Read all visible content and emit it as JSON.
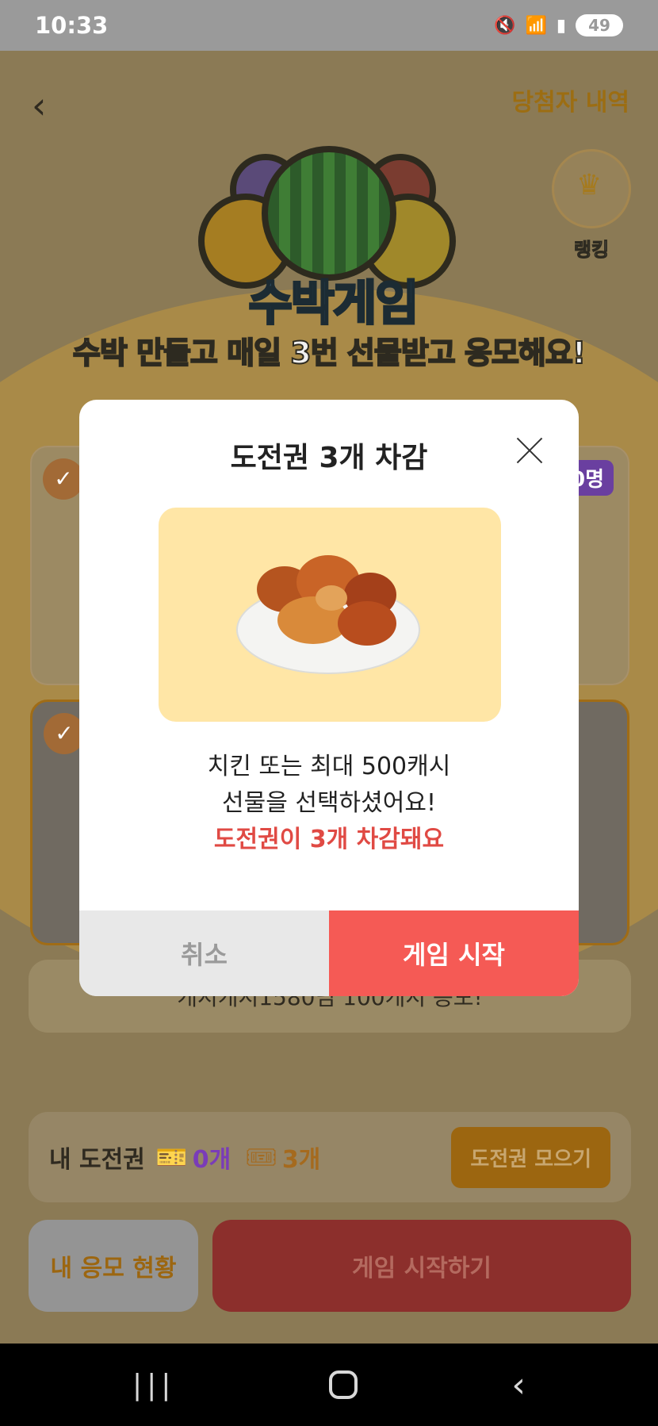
{
  "status_bar": {
    "time": "10:33",
    "battery": "49",
    "icons": [
      "mute-icon",
      "wifi-icon",
      "signal-icon",
      "battery-icon"
    ]
  },
  "header": {
    "winners_link": "당첨자 내역"
  },
  "logo": {
    "text": "수박게임"
  },
  "ranking": {
    "label": "랭킹"
  },
  "headline": "수박 만들고 매일 3번 선물받고 응모해요!",
  "background_card": {
    "count_badge": "0명"
  },
  "notice": "캐시캐시1580님 100개시 응모!",
  "tickets": {
    "label": "내 도전권",
    "purple_count": "0개",
    "orange_count": "3개",
    "collect_button": "도전권 모으기"
  },
  "my_entries_button": "내 응모 현황",
  "start_game_big_button": "게임 시작하기",
  "modal": {
    "title": "도전권 3개 차감",
    "line1": "치킨 또는 최대 500캐시",
    "line2": "선물을 선택하셨어요!",
    "warning": "도전권이 3개 차감돼요",
    "cancel_label": "취소",
    "start_label": "게임 시작"
  },
  "colors": {
    "accent_red": "#f55a55",
    "warning_red": "#e04a44",
    "prize_bg": "#ffe6a6",
    "dim_overlay": "#8b7a55"
  }
}
